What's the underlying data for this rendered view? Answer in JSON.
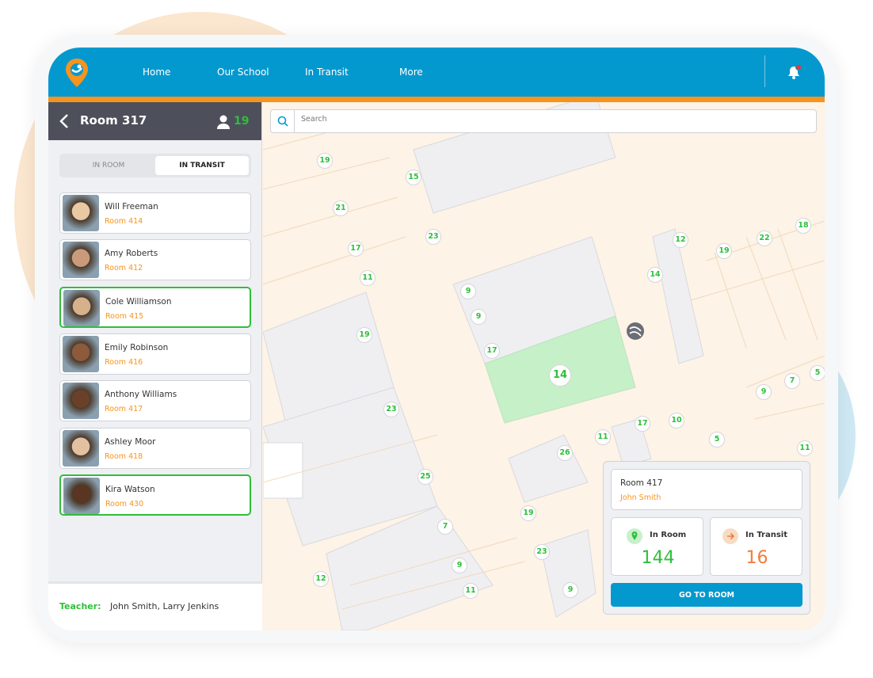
{
  "colors": {
    "brand": "#0399cf",
    "accent": "#f7941d",
    "success": "#2fbf3a",
    "transit": "#f47c3c"
  },
  "nav": {
    "items": [
      "Home",
      "Our School",
      "In Transit",
      "More"
    ],
    "notification_icon": "bell-icon"
  },
  "sidebar": {
    "room_title": "Room 317",
    "student_count": "19",
    "tabs": [
      "IN ROOM",
      "IN TRANSIT"
    ],
    "active_tab": "IN TRANSIT",
    "students": [
      {
        "name": "Will Freeman",
        "room": "Room 414",
        "selected": false
      },
      {
        "name": "Amy Roberts",
        "room": "Room 412",
        "selected": false
      },
      {
        "name": "Cole Williamson",
        "room": "Room 415",
        "selected": true
      },
      {
        "name": "Emily Robinson",
        "room": "Room 416",
        "selected": false
      },
      {
        "name": "Anthony Williams",
        "room": "Room 417",
        "selected": false
      },
      {
        "name": "Ashley Moor",
        "room": "Room 418",
        "selected": false
      },
      {
        "name": "Kira Watson",
        "room": "Room 430",
        "selected": true
      }
    ],
    "teacher_label": "Teacher:",
    "teacher_names": "John Smith, Larry Jenkins"
  },
  "search": {
    "placeholder": "Search"
  },
  "map": {
    "markers": [
      "19",
      "15",
      "21",
      "23",
      "17",
      "11",
      "19",
      "9",
      "9",
      "17",
      "14",
      "23",
      "25",
      "7",
      "9",
      "11",
      "12",
      "12",
      "19",
      "22",
      "18",
      "14",
      "5",
      "7",
      "9",
      "17",
      "10",
      "11",
      "26",
      "5",
      "11",
      "19",
      "23",
      "9"
    ]
  },
  "room_panel": {
    "room": "Room 417",
    "teacher": "John Smith",
    "in_room_label": "In Room",
    "in_room_count": "144",
    "in_transit_label": "In Transit",
    "in_transit_count": "16",
    "button": "GO TO ROOM"
  }
}
